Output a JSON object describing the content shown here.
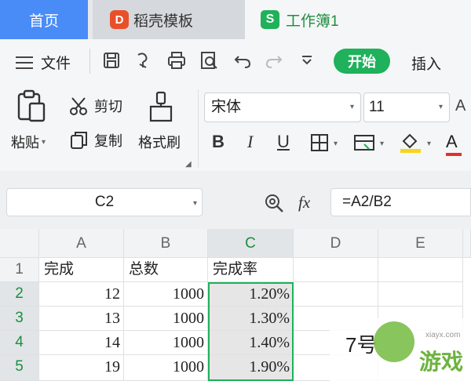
{
  "tabs": {
    "home": "首页",
    "templates": "稻壳模板",
    "workbook": "工作簿1",
    "templates_logo": "D",
    "workbook_logo": "S"
  },
  "menu": {
    "file": "文件",
    "start": "开始",
    "insert": "插入"
  },
  "ribbon": {
    "paste": "粘贴",
    "cut": "剪切",
    "copy": "复制",
    "format_painter": "格式刷",
    "font_name": "宋体",
    "font_size": "11",
    "bold": "B",
    "italic": "I",
    "underline": "U",
    "font_color": "A"
  },
  "formula_bar": {
    "cell_ref": "C2",
    "fx": "fx",
    "formula": "=A2/B2"
  },
  "sheet": {
    "columns": [
      "A",
      "B",
      "C",
      "D",
      "E"
    ],
    "row_numbers": [
      "1",
      "2",
      "3",
      "4",
      "5"
    ],
    "headers": [
      "完成",
      "总数",
      "完成率"
    ],
    "rows": [
      [
        "12",
        "1000",
        "1.20%"
      ],
      [
        "13",
        "1000",
        "1.30%"
      ],
      [
        "14",
        "1000",
        "1.40%"
      ],
      [
        "19",
        "1000",
        "1.90%"
      ]
    ]
  },
  "watermark": {
    "main": "游戏",
    "small": "xiayx.com",
    "num": "7号"
  },
  "colors": {
    "accent_blue": "#4a8cf7",
    "accent_green": "#1fb15b",
    "logo_orange": "#e8502a"
  }
}
